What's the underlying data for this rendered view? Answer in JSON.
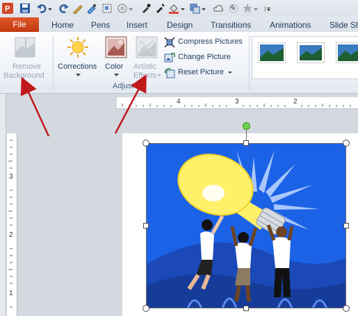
{
  "tabs": {
    "file": "File",
    "home": "Home",
    "pens": "Pens",
    "insert": "Insert",
    "design": "Design",
    "transitions": "Transitions",
    "animations": "Animations",
    "slide_show": "Slide Sh"
  },
  "ribbon": {
    "remove_background": {
      "line1": "Remove",
      "line2": "Background"
    },
    "corrections": "Corrections",
    "color": "Color",
    "artistic_effects": {
      "line1": "Artistic",
      "line2": "Effects"
    },
    "compress_pictures": "Compress Pictures",
    "change_picture": "Change Picture",
    "reset_picture": "Reset Picture",
    "group_label": "Adjust"
  },
  "ruler": {
    "top_marks": [
      "4",
      "3",
      "2"
    ],
    "left_marks": [
      "3",
      "2",
      "1"
    ]
  },
  "colors": {
    "file_tab": "#c9431a",
    "arrow": "#c0191c",
    "picture_bg": "#1a5fe0"
  }
}
